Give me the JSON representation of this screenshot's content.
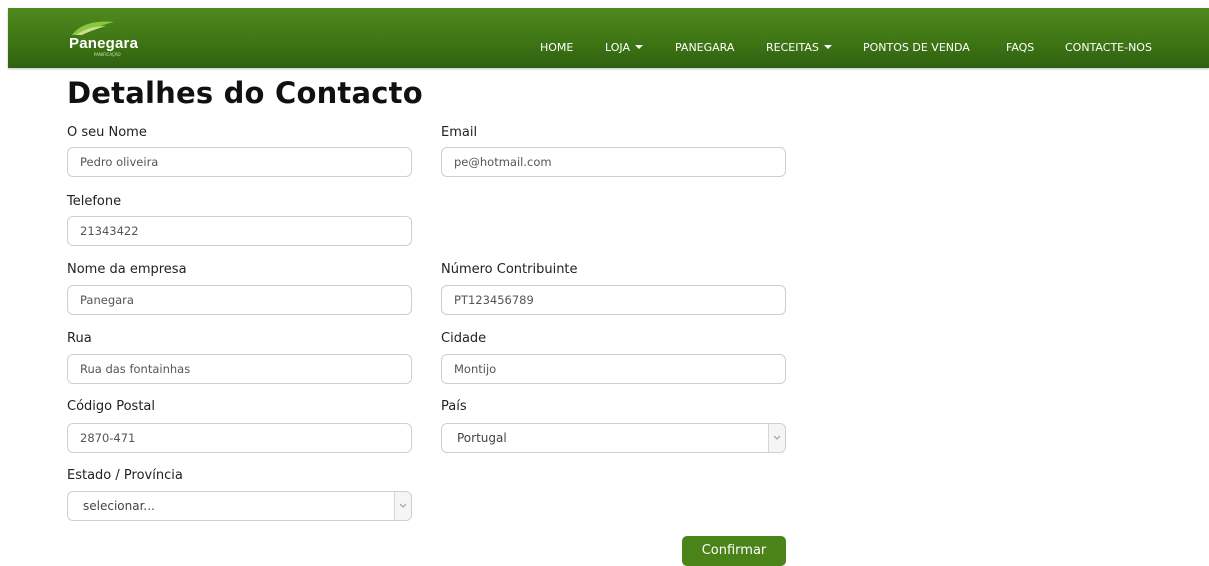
{
  "brand": {
    "name": "Panegara",
    "tagline": "PANIFICAÇÃO"
  },
  "nav": {
    "items": [
      {
        "label": "HOME",
        "dropdown": false
      },
      {
        "label": "LOJA",
        "dropdown": true
      },
      {
        "label": "PANEGARA",
        "dropdown": false
      },
      {
        "label": "RECEITAS",
        "dropdown": true
      },
      {
        "label": "PONTOS DE VENDA",
        "dropdown": false
      },
      {
        "label": "FAQS",
        "dropdown": false
      },
      {
        "label": "CONTACTE-NOS",
        "dropdown": false
      }
    ]
  },
  "page": {
    "title": "Detalhes do Contacto"
  },
  "form": {
    "name": {
      "label": "O seu Nome",
      "value": "Pedro oliveira"
    },
    "email": {
      "label": "Email",
      "value": "pe@hotmail.com"
    },
    "phone": {
      "label": "Telefone",
      "value": "21343422"
    },
    "company": {
      "label": "Nome da empresa",
      "value": "Panegara"
    },
    "vat": {
      "label": "Número Contribuinte",
      "value": "PT123456789"
    },
    "street": {
      "label": "Rua",
      "value": "Rua das fontainhas"
    },
    "city": {
      "label": "Cidade",
      "value": "Montijo"
    },
    "postal": {
      "label": "Código Postal",
      "value": "2870-471"
    },
    "country": {
      "label": "País",
      "value": "Portugal"
    },
    "state": {
      "label": "Estado / Província",
      "value": "selecionar..."
    },
    "submit_label": "Confirmar"
  },
  "colors": {
    "nav_bg": "#3d7414",
    "button_bg": "#4a8317"
  }
}
